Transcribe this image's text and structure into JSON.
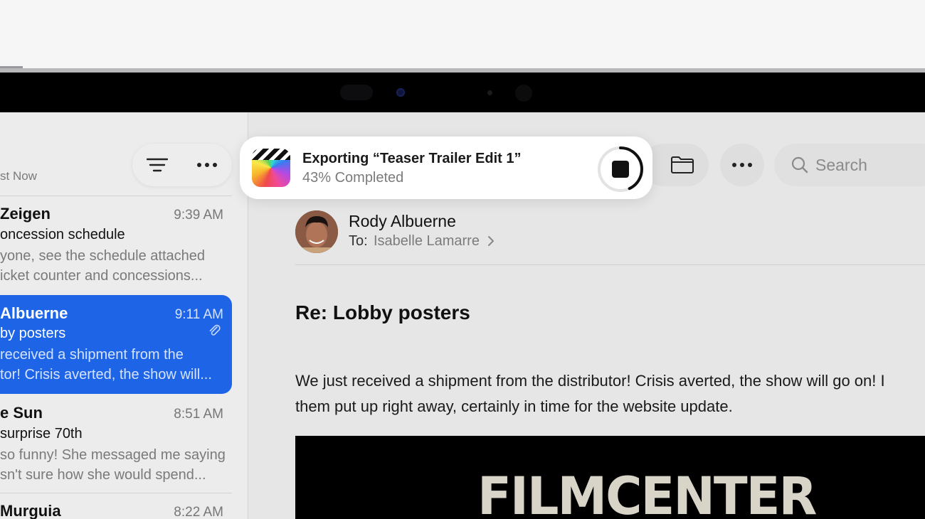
{
  "list": {
    "just_now": "st Now",
    "items": [
      {
        "sender": "Zeigen",
        "time": "9:39 AM",
        "subject": "oncession schedule",
        "preview1": "yone, see the schedule attached",
        "preview2": "icket counter and concessions..."
      },
      {
        "sender": "Albuerne",
        "time": "9:11 AM",
        "subject": "by posters",
        "preview1": "received a shipment from the",
        "preview2": "tor! Crisis averted, the show will...",
        "selected": true,
        "attachment": true
      },
      {
        "sender": "e Sun",
        "time": "8:51 AM",
        "subject": "surprise 70th",
        "preview1": "so funny! She messaged me saying",
        "preview2": "sn't sure how she would spend..."
      },
      {
        "sender": "Murguia",
        "time": "8:22 AM"
      }
    ]
  },
  "export": {
    "title": "Exporting “Teaser Trailer Edit 1”",
    "progress_text": "43% Completed",
    "progress": 0.43
  },
  "toolbar": {
    "search_placeholder": "Search"
  },
  "message": {
    "from": "Rody Albuerne",
    "to_label": "To:",
    "to_name": "Isabelle Lamarre",
    "subject": "Re: Lobby posters",
    "body_line1": "We just received a shipment from the distributor! Crisis averted, the show will go on! I",
    "body_line2": "them put up right away, certainly in time for the website update.",
    "poster_text": "FILMCENTER"
  },
  "colors": {
    "accent": "#1d64e6",
    "export_card": "#ffffff"
  },
  "icons": [
    "filter-icon",
    "more-icon",
    "folder-icon",
    "search-icon",
    "stop-icon",
    "paperclip-icon",
    "chevron-right-icon",
    "final-cut-pro-icon"
  ]
}
